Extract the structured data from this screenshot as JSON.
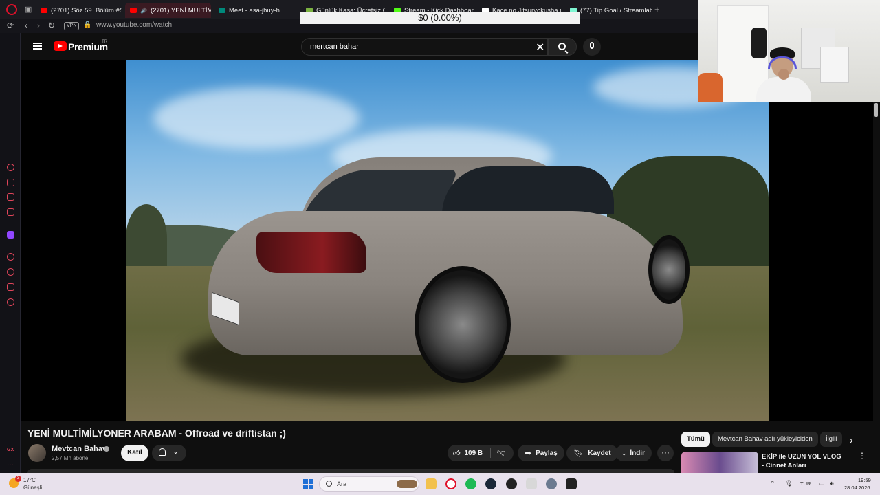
{
  "browser": {
    "tabs": [
      {
        "label": "(2701) Söz 59. Bölüm #Sar",
        "color": "#ff0000"
      },
      {
        "label": "(2701) YENİ MULTİMİ",
        "color": "#ff0000",
        "active": true
      },
      {
        "label": "Meet - asa-jhuy-h",
        "color": "#00897b"
      },
      {
        "label": "Günlük Kasa: Ücretsiz CS",
        "color": "#7cb342"
      },
      {
        "label": "Stream - Kick Dashboard",
        "color": "#53fc18"
      },
      {
        "label": "Kaçe no Jitsuryokusha ni",
        "color": "#ffffff"
      },
      {
        "label": "(77) Tip Goal / Streamlabs",
        "color": "#80f5d2"
      }
    ],
    "address": {
      "vpn_label": "VPN",
      "url": "www.youtube.com/watch"
    }
  },
  "overlay": {
    "goal_text": "$0 (0.00%)"
  },
  "sidebar": {
    "bottom_label": "GX",
    "more_label": "···"
  },
  "youtube": {
    "brand": "Premium",
    "region": "TR",
    "search_value": "mertcan bahar",
    "video": {
      "title": "YENİ MULTİMİLYONER ARABAM - Offroad ve driftistan ;)",
      "channel": "Mevtcan Bahav",
      "subscribers": "2,57 Mn abone",
      "join_label": "Katıl",
      "likes": "109 B",
      "share_label": "Paylaş",
      "save_label": "Kaydet",
      "download_label": "İndir"
    },
    "chips": [
      "Tümü",
      "Mevtcan Bahav adlı yükleyiciden",
      "İlgili"
    ],
    "recommendation": {
      "title": "EKİP ile UZUN YOL VLOG - Cinnet Anları"
    }
  },
  "taskbar": {
    "weather_badge": "3",
    "temperature": "17°C",
    "condition": "Güneşli",
    "search_label": "Ara",
    "language": "TUR",
    "time": "19:59",
    "date": "28.04.2026"
  },
  "colors": {
    "youtube_red": "#ff0000",
    "opera_red": "#e0112b",
    "background": "#0f0f0f"
  }
}
